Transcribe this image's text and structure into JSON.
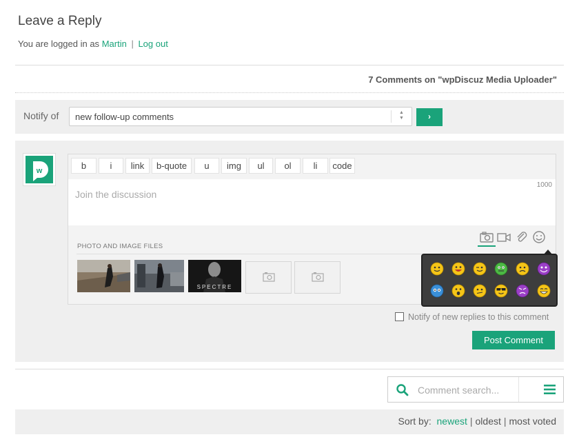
{
  "header": {
    "title": "Leave a Reply",
    "logged_in_prefix": "You are logged in as",
    "user_name": "Martin",
    "separator": "|",
    "logout_label": "Log out"
  },
  "comments_count_label": "7 Comments on \"wpDiscuz Media Uploader\"",
  "notify": {
    "label": "Notify of",
    "selected_value": "new follow-up comments",
    "submit_label": "›"
  },
  "avatar": {
    "letter": "w"
  },
  "toolbar": {
    "buttons": [
      "b",
      "i",
      "link",
      "b-quote",
      "u",
      "img",
      "ul",
      "ol",
      "li",
      "code"
    ]
  },
  "editor": {
    "placeholder": "Join the discussion",
    "char_limit": "1000"
  },
  "upload": {
    "section_label": "PHOTO AND IMAGE FILES",
    "tabs": [
      "camera-icon",
      "video-icon",
      "attachment-icon",
      "smiley-icon"
    ],
    "thumbnails": [
      {
        "name": "thumbnail-1"
      },
      {
        "name": "thumbnail-2"
      },
      {
        "name": "thumbnail-3",
        "caption": "SPECTRE"
      }
    ],
    "empty_slots": 2
  },
  "emoji_icons": [
    "smile-emoji",
    "laugh-emoji",
    "wink-emoji",
    "green-emoji",
    "sad-emoji",
    "purple-devil-emoji",
    "blue-emoji",
    "surprised-emoji",
    "confused-emoji",
    "cool-emoji",
    "purple-angry-emoji",
    "grin-emoji"
  ],
  "notify_replies_label": "Notify of new replies to this comment",
  "post_button_label": "Post Comment",
  "search": {
    "placeholder": "Comment search..."
  },
  "sort": {
    "label": "Sort by:",
    "options": [
      "newest",
      "oldest",
      "most voted"
    ],
    "active": "newest"
  },
  "colors": {
    "accent": "#1aa37a",
    "panel_bg": "#efefef",
    "popup_bg": "#3d3d3d"
  }
}
